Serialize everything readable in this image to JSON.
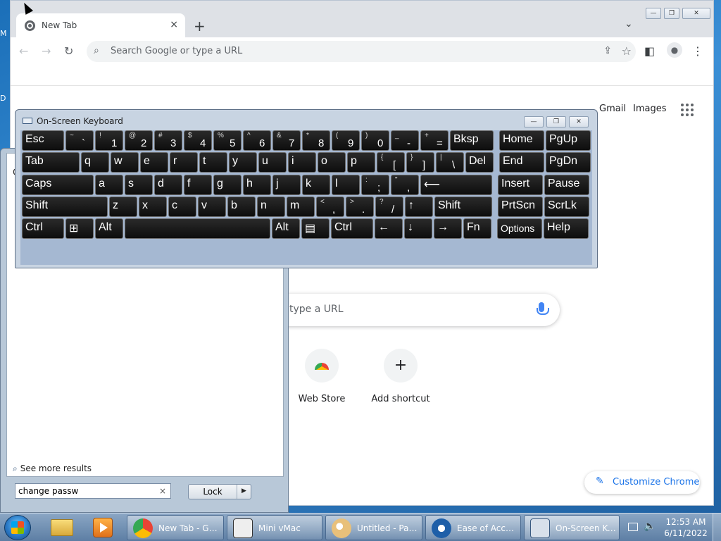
{
  "desktop": {
    "label_m": "M",
    "label_d": "D"
  },
  "chrome": {
    "tab_title": "New Tab",
    "tab_close": "×",
    "new_tab": "+",
    "tab_dropdown": "⌄",
    "window_controls": {
      "minimize": "—",
      "restore": "❐",
      "close": "✕"
    },
    "toolbar": {
      "back": "←",
      "forward": "→",
      "reload": "↻",
      "omnibox_placeholder": "Search Google or type a URL",
      "share": "⇪",
      "star": "☆",
      "sidepanel": "◧",
      "profile": "●",
      "menu": "⋮"
    },
    "ntp": {
      "gmail": "Gmail",
      "images": "Images",
      "search_placeholder": "type a URL",
      "shortcuts": [
        {
          "label": "Web Store"
        },
        {
          "label": "Add shortcut",
          "glyph": "+"
        }
      ],
      "customize": "Customize Chrome",
      "customize_icon": "✎"
    }
  },
  "start_menu": {
    "letter": "C",
    "see_more": "See more results",
    "search_value": "change passw",
    "clear": "×",
    "lock": "Lock",
    "lock_arrow": "▶"
  },
  "osk": {
    "title": "On-Screen Keyboard",
    "window_controls": {
      "minimize": "—",
      "restore": "❐",
      "close": "✕"
    },
    "rows": [
      [
        {
          "t": "Esc"
        },
        {
          "u": "~",
          "d": "`"
        },
        {
          "u": "!",
          "d": "1"
        },
        {
          "u": "@",
          "d": "2"
        },
        {
          "u": "#",
          "d": "3"
        },
        {
          "u": "$",
          "d": "4"
        },
        {
          "u": "%",
          "d": "5"
        },
        {
          "u": "^",
          "d": "6"
        },
        {
          "u": "&",
          "d": "7"
        },
        {
          "u": "*",
          "d": "8"
        },
        {
          "u": "(",
          "d": "9"
        },
        {
          "u": ")",
          "d": "0"
        },
        {
          "u": "_",
          "d": "-"
        },
        {
          "u": "+",
          "d": "="
        },
        {
          "t": "Bksp"
        },
        {
          "t": "Home"
        },
        {
          "t": "PgUp"
        }
      ],
      [
        {
          "t": "Tab"
        },
        {
          "t": "q"
        },
        {
          "t": "w"
        },
        {
          "t": "e"
        },
        {
          "t": "r"
        },
        {
          "t": "t"
        },
        {
          "t": "y"
        },
        {
          "t": "u"
        },
        {
          "t": "i"
        },
        {
          "t": "o"
        },
        {
          "t": "p"
        },
        {
          "u": "{",
          "d": "["
        },
        {
          "u": "}",
          "d": "]"
        },
        {
          "u": "|",
          "d": "\\"
        },
        {
          "t": "Del"
        },
        {
          "t": "End"
        },
        {
          "t": "PgDn"
        }
      ],
      [
        {
          "t": "Caps"
        },
        {
          "t": "a"
        },
        {
          "t": "s"
        },
        {
          "t": "d"
        },
        {
          "t": "f"
        },
        {
          "t": "g"
        },
        {
          "t": "h"
        },
        {
          "t": "j"
        },
        {
          "t": "k"
        },
        {
          "t": "l"
        },
        {
          "u": ":",
          "d": ";"
        },
        {
          "u": "\"",
          "d": ","
        },
        {
          "t": "⟵"
        },
        {
          "t": "Insert"
        },
        {
          "t": "Pause"
        }
      ],
      [
        {
          "t": "Shift"
        },
        {
          "t": "z"
        },
        {
          "t": "x"
        },
        {
          "t": "c"
        },
        {
          "t": "v"
        },
        {
          "t": "b"
        },
        {
          "t": "n"
        },
        {
          "t": "m"
        },
        {
          "u": "<",
          "d": ","
        },
        {
          "u": ">",
          "d": "."
        },
        {
          "u": "?",
          "d": "/"
        },
        {
          "t": "↑"
        },
        {
          "t": "Shift"
        },
        {
          "t": "PrtScn"
        },
        {
          "t": "ScrLk"
        }
      ],
      [
        {
          "t": "Ctrl"
        },
        {
          "t": "⊞"
        },
        {
          "t": "Alt"
        },
        {
          "t": ""
        },
        {
          "t": "Alt"
        },
        {
          "t": "▤"
        },
        {
          "t": "Ctrl"
        },
        {
          "t": "←"
        },
        {
          "t": "↓"
        },
        {
          "t": "→"
        },
        {
          "t": "Fn"
        },
        {
          "t": "Options"
        },
        {
          "t": "Help"
        }
      ]
    ]
  },
  "taskbar": {
    "tasks": [
      {
        "label": "New Tab - Go..."
      },
      {
        "label": "Mini vMac"
      },
      {
        "label": "Untitled - Paint"
      },
      {
        "label": "Ease of Access"
      },
      {
        "label": "On-Screen Ke..."
      }
    ],
    "time": "12:53 AM",
    "date": "6/11/2022"
  }
}
